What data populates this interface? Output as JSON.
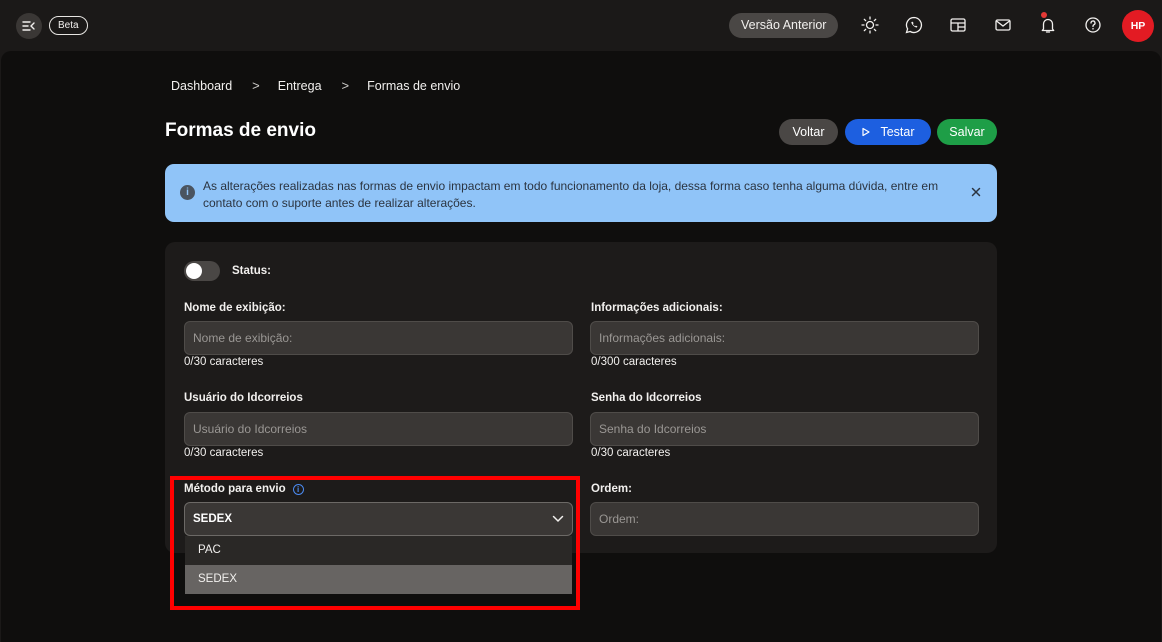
{
  "topbar": {
    "beta_label": "Beta",
    "versao_label": "Versão Anterior",
    "avatar_initials": "HP"
  },
  "breadcrumb": {
    "items": [
      "Dashboard",
      "Entrega",
      "Formas de envio"
    ],
    "separator": ">"
  },
  "page": {
    "title": "Formas de envio",
    "voltar_label": "Voltar",
    "testar_label": "Testar",
    "salvar_label": "Salvar"
  },
  "alert": {
    "text": "As alterações realizadas nas formas de envio impactam em todo funcionamento da loja, dessa forma caso tenha alguma dúvida, entre em contato com o suporte antes de realizar alterações."
  },
  "form": {
    "status_label": "Status:",
    "nome": {
      "label": "Nome de exibição:",
      "placeholder": "Nome de exibição:",
      "count": "0/30 caracteres"
    },
    "info": {
      "label": "Informações adicionais:",
      "placeholder": "Informações adicionais:",
      "count": "0/300 caracteres"
    },
    "usuario": {
      "label": "Usuário do Idcorreios",
      "placeholder": "Usuário do Idcorreios",
      "count": "0/30 caracteres"
    },
    "senha": {
      "label": "Senha do Idcorreios",
      "placeholder": "Senha do Idcorreios",
      "count": "0/30 caracteres"
    },
    "metodo": {
      "label": "Método para envio",
      "value": "SEDEX",
      "options": [
        "PAC",
        "SEDEX"
      ]
    },
    "ordem": {
      "label": "Ordem:",
      "placeholder": "Ordem:"
    }
  },
  "colors": {
    "accent_blue": "#1d5fe0",
    "accent_green": "#1e9e47",
    "alert_bg": "#90c4f8",
    "highlight": "#ff0000",
    "avatar_bg": "#e31b23"
  }
}
